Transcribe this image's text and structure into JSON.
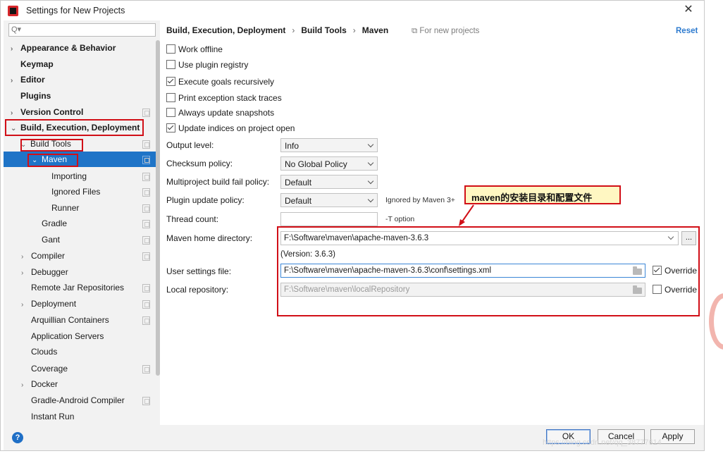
{
  "window": {
    "title": "Settings for New Projects",
    "close_label": "✕"
  },
  "search": {
    "placeholder": "Q▾"
  },
  "tree": {
    "appearance": "Appearance & Behavior",
    "keymap": "Keymap",
    "editor": "Editor",
    "plugins": "Plugins",
    "vcs": "Version Control",
    "bed": "Build, Execution, Deployment",
    "build_tools": "Build Tools",
    "maven": "Maven",
    "importing": "Importing",
    "ignored": "Ignored Files",
    "runner": "Runner",
    "gradle": "Gradle",
    "gant": "Gant",
    "compiler": "Compiler",
    "debugger": "Debugger",
    "remote_jar": "Remote Jar Repositories",
    "deployment": "Deployment",
    "arquillian": "Arquillian Containers",
    "app_servers": "Application Servers",
    "clouds": "Clouds",
    "coverage": "Coverage",
    "docker": "Docker",
    "gradle_android": "Gradle-Android Compiler",
    "instant_run": "Instant Run"
  },
  "breadcrumb": {
    "a": "Build, Execution, Deployment",
    "b": "Build Tools",
    "c": "Maven",
    "sep": "›"
  },
  "for_new_projects": "⧉ For new projects",
  "reset": "Reset",
  "options": {
    "work_offline": {
      "label": "Work offline",
      "checked": false
    },
    "plugin_registry": {
      "label": "Use plugin registry",
      "checked": false
    },
    "goals_recursive": {
      "label": "Execute goals recursively",
      "checked": true
    },
    "stack_traces": {
      "label": "Print exception stack traces",
      "checked": false
    },
    "snapshots": {
      "label": "Always update snapshots",
      "checked": false
    },
    "update_indices": {
      "label": "Update indices on project open",
      "checked": true
    }
  },
  "fields": {
    "output_level": {
      "label": "Output level:",
      "value": "Info"
    },
    "checksum": {
      "label": "Checksum policy:",
      "value": "No Global Policy"
    },
    "multiproject": {
      "label": "Multiproject build fail policy:",
      "value": "Default"
    },
    "plugin_update": {
      "label": "Plugin update policy:",
      "value": "Default",
      "hint": "Ignored by Maven 3+"
    },
    "thread_count": {
      "label": "Thread count:",
      "value": "",
      "hint": "-T option"
    },
    "maven_home": {
      "label": "Maven home directory:",
      "value": "F:\\Software\\maven\\apache-maven-3.6.3",
      "version": "(Version: 3.6.3)",
      "browse": "..."
    },
    "user_settings": {
      "label": "User settings file:",
      "value": "F:\\Software\\maven\\apache-maven-3.6.3\\conf\\settings.xml",
      "override_label": "Override",
      "override": true
    },
    "local_repo": {
      "label": "Local repository:",
      "value": "F:\\Software\\maven\\localRepository",
      "override_label": "Override",
      "override": false
    }
  },
  "annotation": "maven的安装目录和配置文件",
  "buttons": {
    "ok": "OK",
    "cancel": "Cancel",
    "apply": "Apply",
    "help": "?"
  },
  "watermark": "https://blog.csdn.net/qq_38777614",
  "colors": {
    "selection": "#1f74c7",
    "highlight": "#d10f17",
    "callout_bg": "#fff7c2",
    "link": "#2e7bcf"
  }
}
